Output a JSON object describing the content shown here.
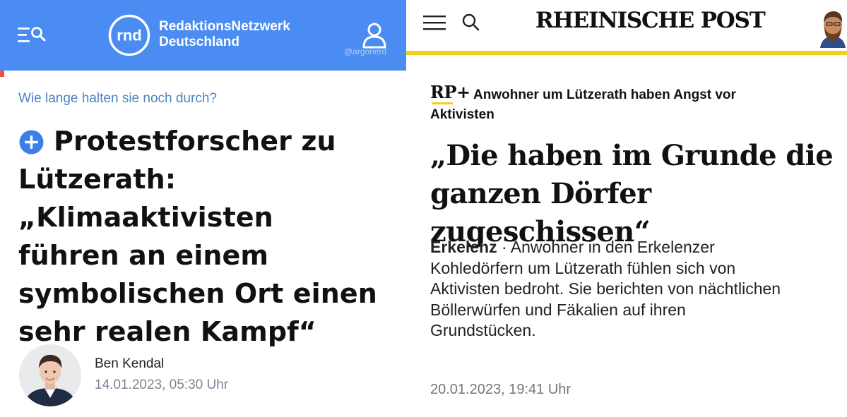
{
  "rnd": {
    "brand_line1": "RedaktionsNetzwerk",
    "brand_line2": "Deutschland",
    "logo_text": "rnd",
    "watermark": "@argonerd",
    "kicker": "Wie lange halten sie noch durch?",
    "title_line1": "Protestforscher zu",
    "title_line2": "Lützerath: „Klimaaktivisten",
    "title_line3": "führen an einem",
    "title_line4": "symbolischen Ort einen",
    "title_line5": "sehr realen Kampf“",
    "author": "Ben Kendal",
    "date": "14.01.2023, 05:30 Uhr",
    "colors": {
      "header": "#4a8cf2",
      "accent": "#e8523f",
      "kicker": "#4f83c4"
    },
    "icons": [
      "menu-search-icon",
      "user-icon",
      "plus-circle-icon"
    ]
  },
  "rp": {
    "logo": "RHEINISCHE POST",
    "badge": "RP+",
    "kicker_line1": "Anwohner um Lützerath haben Angst vor",
    "kicker_line2": "Aktivisten",
    "headline_line1": "„Die haben im Grunde die",
    "headline_line2": "ganzen Dörfer zugeschissen“",
    "teaser_location": "Erkelenz",
    "teaser_separator": " · ",
    "teaser_line1": "Anwohner in den Erkelenzer",
    "teaser_line2": "Kohledörfern um Lützerath fühlen sich von",
    "teaser_line3": "Aktivisten bedroht. Sie berichten von nächtlichen",
    "teaser_line4": "Böllerwürfen und Fäkalien auf ihren",
    "teaser_line5": "Grundstücken.",
    "date": "20.01.2023, 19:41 Uhr",
    "colors": {
      "accent": "#f5cd1c"
    },
    "icons": [
      "hamburger-menu-icon",
      "search-icon"
    ]
  }
}
